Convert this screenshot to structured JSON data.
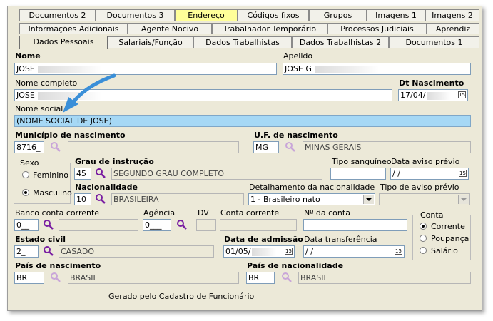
{
  "tabs": {
    "row1": [
      "Documentos 2",
      "Documentos 3",
      "Endereço",
      "Códigos fixos",
      "Grupos",
      "Imagens 1",
      "Imagens 2"
    ],
    "row2": [
      "Informações Adicionais",
      "Agente Nocivo",
      "Trabalhador Temporário",
      "Processos Judiciais",
      "Aprendiz"
    ],
    "row3": [
      "Dados Pessoais",
      "Salariais/Função",
      "Dados Trabalhistas",
      "Dados Trabalhistas 2",
      "Documentos 1"
    ]
  },
  "form": {
    "nome": {
      "label": "Nome",
      "value": "JOSE"
    },
    "apelido": {
      "label": "Apelido",
      "value": "JOSE G"
    },
    "nome_completo": {
      "label": "Nome completo",
      "value": "JOSE"
    },
    "dt_nascimento": {
      "label": "Dt Nascimento",
      "value": "17/04/"
    },
    "nome_social": {
      "label": "Nome social",
      "value": "(NOME SOCIAL DE JOSE)"
    },
    "municipio": {
      "label": "Município de nascimento",
      "code": "8716_",
      "name": ""
    },
    "uf": {
      "label": "U.F. de nascimento",
      "code": "MG",
      "name": "MINAS GERAIS"
    },
    "sexo": {
      "label": "Sexo",
      "options": [
        "Feminino",
        "Masculino"
      ],
      "selected": "Masculino"
    },
    "grau": {
      "label": "Grau de instrução",
      "code": "45",
      "name": "SEGUNDO GRAU COMPLETO"
    },
    "tipo_sanguineo": {
      "label": "Tipo sanguíneo",
      "value": ""
    },
    "data_aviso": {
      "label": "Data aviso prévio",
      "value": " / /"
    },
    "nacionalidade": {
      "label": "Nacionalidade",
      "code": "10",
      "name": "BRASILEIRA"
    },
    "detalhamento": {
      "label": "Detalhamento da nacionalidade",
      "value": "1 - Brasileiro nato"
    },
    "tipo_aviso": {
      "label": "Tipo de aviso prévio",
      "value": ""
    },
    "banco": {
      "label": "Banco conta corrente",
      "code": "0__",
      "name": ""
    },
    "agencia": {
      "label": "Agência",
      "value": "0___"
    },
    "dv": {
      "label": "DV",
      "value": ""
    },
    "conta_corrente": {
      "label": "Conta corrente",
      "value": ""
    },
    "numero_conta": {
      "label": "Nº da conta",
      "value": ""
    },
    "conta": {
      "label": "Conta",
      "options": [
        "Corrente",
        "Poupança",
        "Salário"
      ],
      "selected": "Corrente"
    },
    "estado_civil": {
      "label": "Estado civil",
      "code": "2_",
      "name": "CASADO"
    },
    "data_admissao": {
      "label": "Data de admissão",
      "value": "01/05/"
    },
    "data_transferencia": {
      "label": "Data transferência",
      "value": " / /"
    },
    "pais_nascimento": {
      "label": "País de nascimento",
      "code": "BR",
      "name": "BRASIL"
    },
    "pais_nacionalidade": {
      "label": "País de nacionalidade",
      "code": "BR",
      "name": "BRASIL"
    },
    "footer": "Gerado pelo Cadastro de Funcionário"
  },
  "colors": {
    "highlight_tab": "#ffff99",
    "nome_social_bg": "#a6d8f5",
    "arrow": "#3a8fd8",
    "magnifier": "#7a1fa2"
  }
}
